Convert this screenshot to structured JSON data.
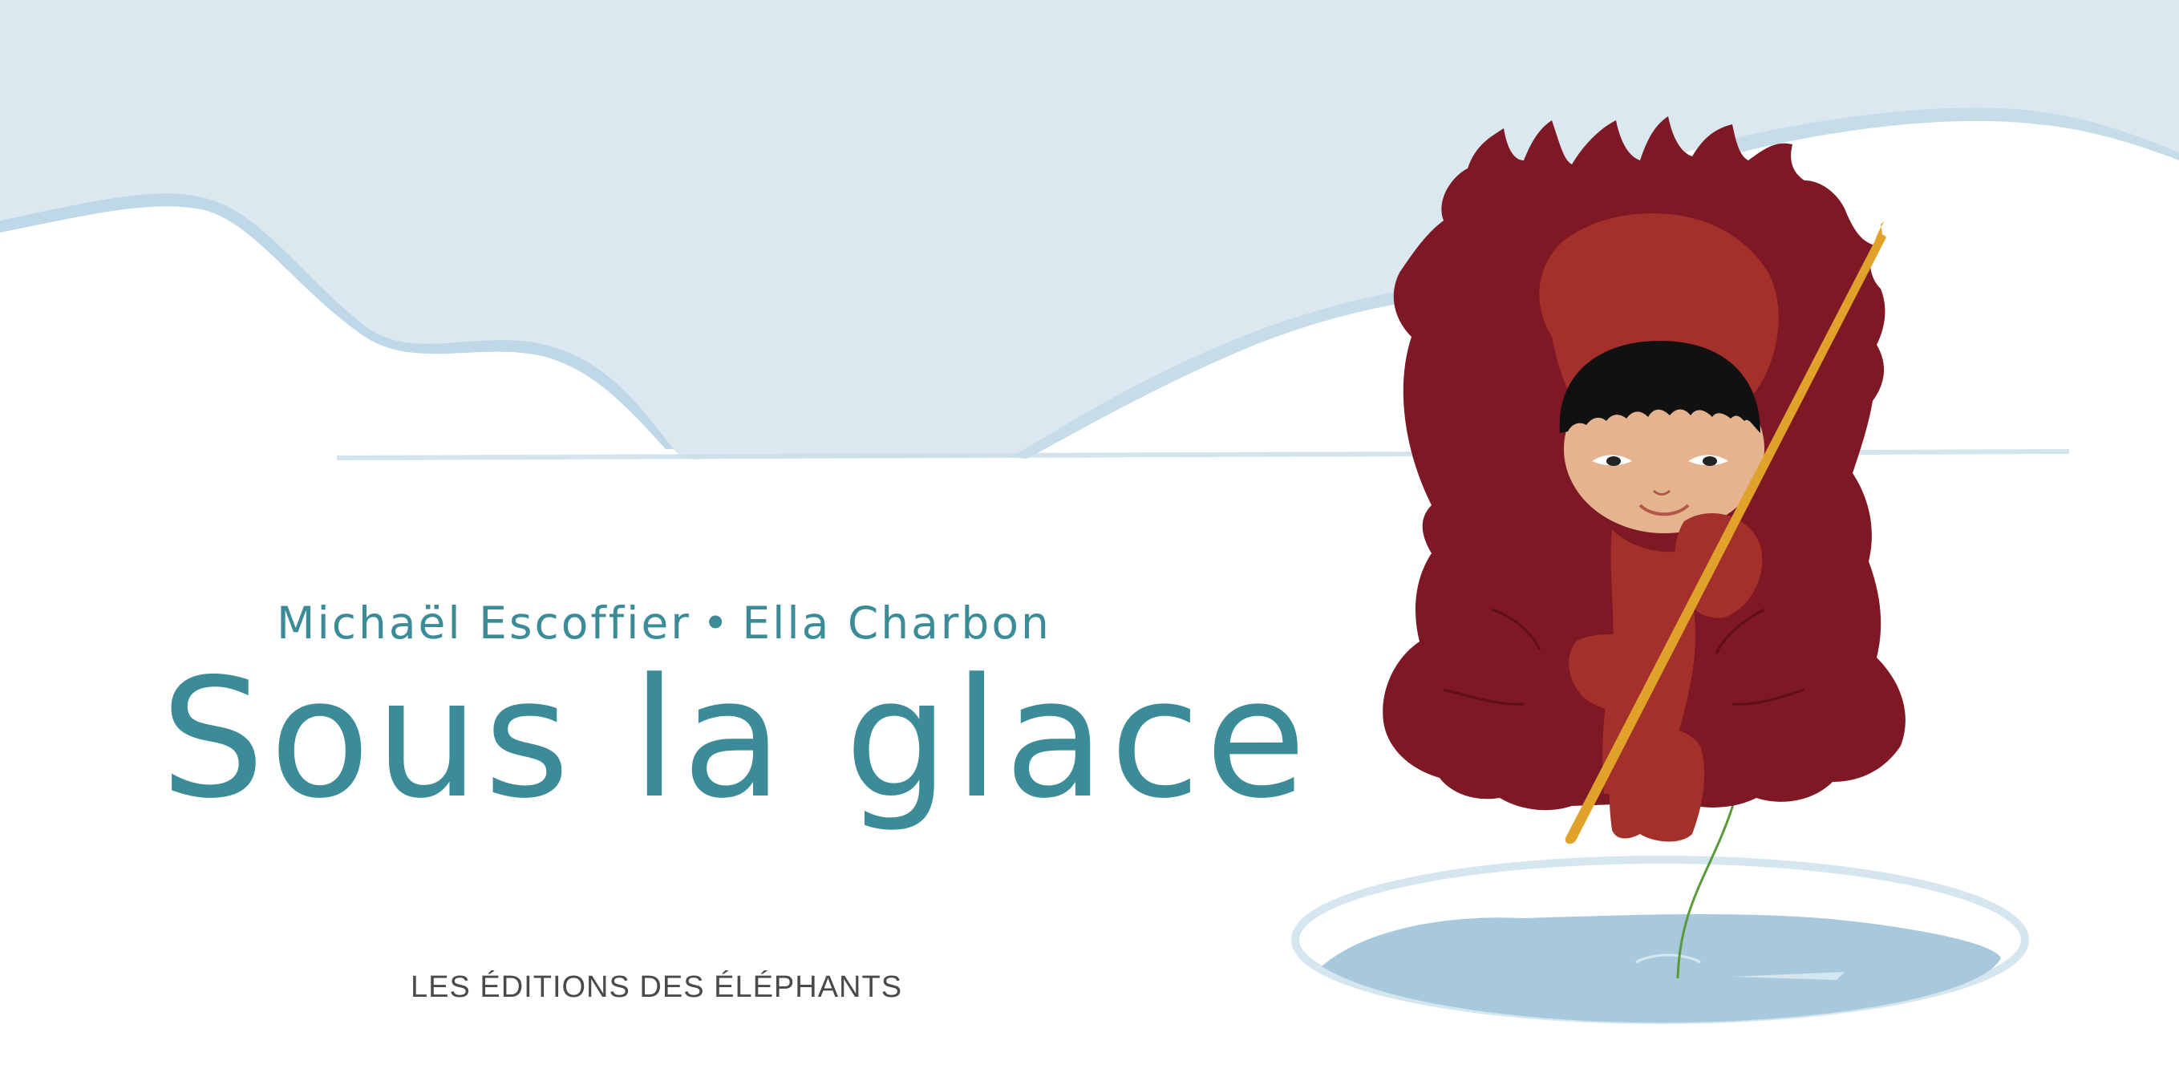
{
  "book": {
    "author_1": "Michaël Escoffier",
    "separator": "•",
    "author_2": "Ella Charbon",
    "title": "Sous la glace",
    "publisher": "LES ÉDITIONS DES ÉLÉPHANTS"
  },
  "illustration": {
    "subject": "child in red fur parka ice fishing",
    "colors": {
      "sky": "#dbe8f0",
      "snow": "#ffffff",
      "ice_shadow": "#b8d4e4",
      "parka": "#7e1824",
      "parka_inner": "#a3302b",
      "skin": "#e6b38f",
      "hair": "#111111",
      "rod": "#e0a22a",
      "line": "#5a9a3a",
      "water": "#a8c9dd",
      "text_accent": "#3b8b98"
    }
  }
}
